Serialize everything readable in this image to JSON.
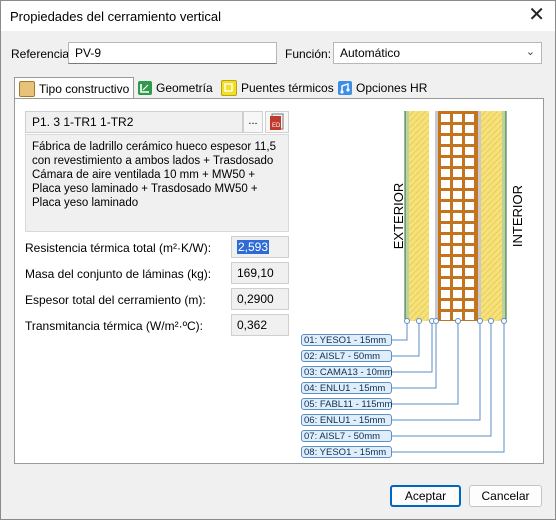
{
  "window": {
    "title": "Propiedades del cerramiento vertical",
    "close_glyph": "✕"
  },
  "form": {
    "referencia_label": "Referencia:",
    "referencia_value": "PV-9",
    "funcion_label": "Función:",
    "funcion_value": "Automático"
  },
  "tabs": [
    {
      "label": "Tipo constructivo",
      "icon": "construction-type-icon",
      "active": true
    },
    {
      "label": "Geometría",
      "icon": "geometry-icon",
      "active": false
    },
    {
      "label": "Puentes térmicos",
      "icon": "thermal-bridge-icon",
      "active": false
    },
    {
      "label": "Opciones HR",
      "icon": "hr-options-icon",
      "active": false
    }
  ],
  "construction": {
    "code": "P1. 3 1-TR1 1-TR2",
    "browse_label": "...",
    "editor_label": "ED",
    "description": "Fábrica de ladrillo cerámico hueco espesor 11,5 con revestimiento a ambos lados + Trasdosado Cámara de aire ventilada 10 mm + MW50 + Placa  yeso laminado + Trasdosado MW50 + Placa  yeso laminado"
  },
  "properties": [
    {
      "label": "Resistencia térmica total (m²·K/W):",
      "value": "2,593",
      "selected": true
    },
    {
      "label": "Masa del conjunto de láminas (kg):",
      "value": "169,10",
      "selected": false
    },
    {
      "label": "Espesor total del cerramiento (m):",
      "value": "0,2900",
      "selected": false
    },
    {
      "label": "Transmitancia térmica (W/m²·ºC):",
      "value": "0,362",
      "selected": false
    }
  ],
  "diagram": {
    "exterior_label": "EXTERIOR",
    "interior_label": "INTERIOR",
    "layers": [
      "01: YESO1 - 15mm",
      "02: AISL7 - 50mm",
      "03: CAMA13 - 10mm",
      "04: ENLU1 - 15mm",
      "05: FABL11 - 115mm",
      "06: ENLU1 - 15mm",
      "07: AISL7 - 50mm",
      "08: YESO1 - 15mm"
    ]
  },
  "buttons": {
    "accept": "Aceptar",
    "cancel": "Cancelar"
  }
}
